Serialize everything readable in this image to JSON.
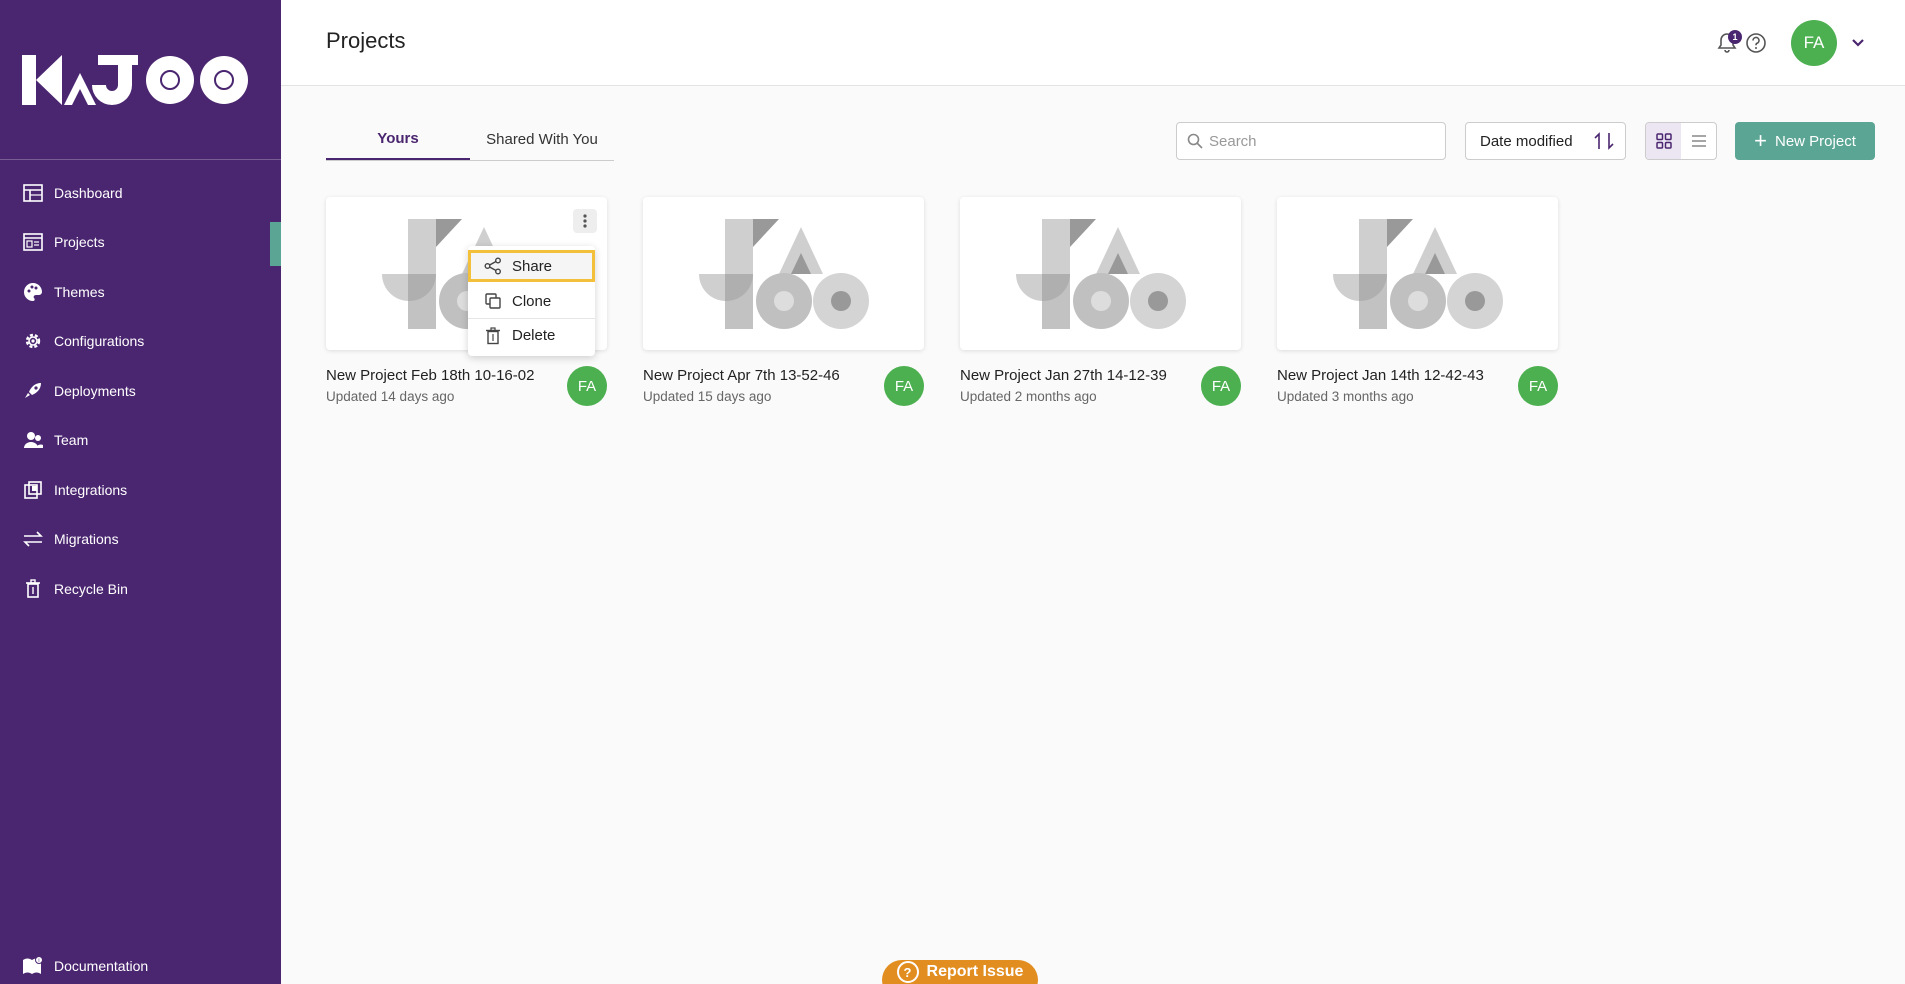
{
  "brand": {
    "logo_text": "KAJOO"
  },
  "sidebar": {
    "items": [
      {
        "label": "Dashboard",
        "icon": "table-icon"
      },
      {
        "label": "Projects",
        "icon": "layout-icon",
        "active": true
      },
      {
        "label": "Themes",
        "icon": "palette-icon"
      },
      {
        "label": "Configurations",
        "icon": "gear-icon"
      },
      {
        "label": "Deployments",
        "icon": "rocket-icon"
      },
      {
        "label": "Team",
        "icon": "users-icon"
      },
      {
        "label": "Integrations",
        "icon": "integrations-icon"
      },
      {
        "label": "Migrations",
        "icon": "arrows-icon"
      },
      {
        "label": "Recycle Bin",
        "icon": "trash-icon"
      }
    ],
    "documentation": "Documentation"
  },
  "header": {
    "title": "Projects",
    "notification_count": "1",
    "avatar_initials": "FA"
  },
  "toolbar": {
    "tabs": [
      {
        "label": "Yours",
        "active": true
      },
      {
        "label": "Shared With You",
        "active": false
      }
    ],
    "search_placeholder": "Search",
    "sort_label": "Date modified",
    "new_project_label": "New Project"
  },
  "projects": [
    {
      "name": "New Project Feb 18th 10-16-02",
      "updated": "Updated 14 days ago",
      "owner": "FA"
    },
    {
      "name": "New Project Apr 7th 13-52-46",
      "updated": "Updated 15 days ago",
      "owner": "FA"
    },
    {
      "name": "New Project Jan 27th 14-12-39",
      "updated": "Updated 2 months ago",
      "owner": "FA"
    },
    {
      "name": "New Project Jan 14th 12-42-43",
      "updated": "Updated 3 months ago",
      "owner": "FA"
    }
  ],
  "context_menu": {
    "items": [
      {
        "label": "Share",
        "icon": "share-icon"
      },
      {
        "label": "Clone",
        "icon": "clone-icon"
      },
      {
        "label": "Delete",
        "icon": "trash-icon"
      }
    ]
  },
  "report_issue": "Report Issue",
  "colors": {
    "sidebar_bg": "#4b2670",
    "accent": "#5ba594",
    "avatar": "#4caf50",
    "report": "#e28d1f",
    "highlight": "#f2c03a"
  }
}
